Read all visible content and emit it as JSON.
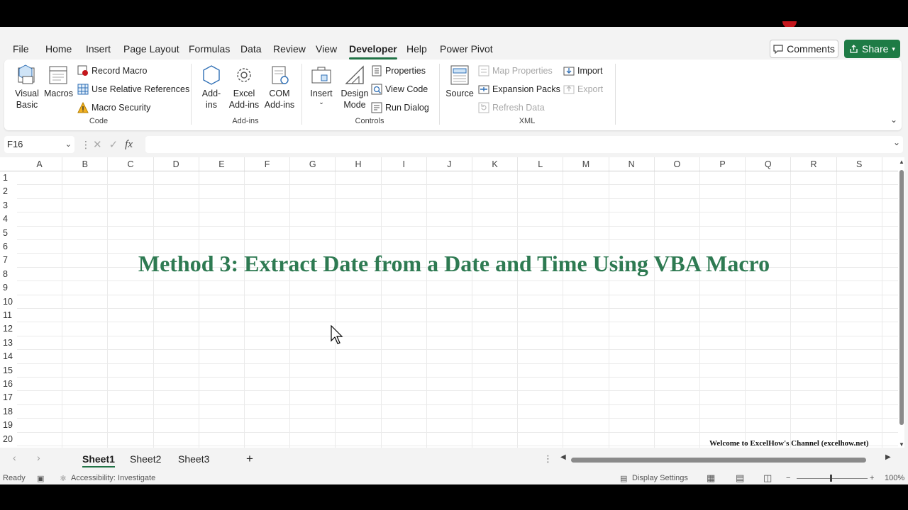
{
  "menu": {
    "tabs": [
      "File",
      "Home",
      "Insert",
      "Page Layout",
      "Formulas",
      "Data",
      "Review",
      "View",
      "Developer",
      "Help",
      "Power Pivot"
    ],
    "active_tab": "Developer",
    "comments_label": "Comments",
    "share_label": "Share"
  },
  "ribbon": {
    "code": {
      "visual_basic": "Visual\nBasic",
      "macros": "Macros",
      "record_macro": "Record Macro",
      "relative_refs": "Use Relative References",
      "macro_security": "Macro Security",
      "group_label": "Code"
    },
    "addins": {
      "addins": "Add-\nins",
      "excel_addins": "Excel\nAdd-ins",
      "com_addins": "COM\nAdd-ins",
      "group_label": "Add-ins"
    },
    "controls": {
      "insert": "Insert",
      "design_mode": "Design\nMode",
      "properties": "Properties",
      "view_code": "View Code",
      "run_dialog": "Run Dialog",
      "group_label": "Controls"
    },
    "xml": {
      "source": "Source",
      "map_properties": "Map Properties",
      "expansion_packs": "Expansion Packs",
      "refresh_data": "Refresh Data",
      "import": "Import",
      "export": "Export",
      "group_label": "XML"
    }
  },
  "formula_bar": {
    "name_box": "F16",
    "fx": "fx",
    "formula": ""
  },
  "grid": {
    "columns": [
      "A",
      "B",
      "C",
      "D",
      "E",
      "F",
      "G",
      "H",
      "I",
      "J",
      "K",
      "L",
      "M",
      "N",
      "O",
      "P",
      "Q",
      "R",
      "S"
    ],
    "rows": [
      "1",
      "2",
      "3",
      "4",
      "5",
      "6",
      "7",
      "8",
      "9",
      "10",
      "11",
      "12",
      "13",
      "14",
      "15",
      "16",
      "17",
      "18",
      "19",
      "20"
    ],
    "title_text": "Method 3: Extract Date from a Date and Time Using VBA Macro",
    "watermark_text": "Welcome to ExcelHow's  Channel (excelhow.net)",
    "title_color": "#2e7a52"
  },
  "sheets": {
    "tabs": [
      "Sheet1",
      "Sheet2",
      "Sheet3"
    ],
    "active": "Sheet1",
    "add_symbol": "+"
  },
  "status": {
    "ready": "Ready",
    "accessibility": "Accessibility: Investigate",
    "display_settings": "Display Settings",
    "zoom": "100%"
  }
}
